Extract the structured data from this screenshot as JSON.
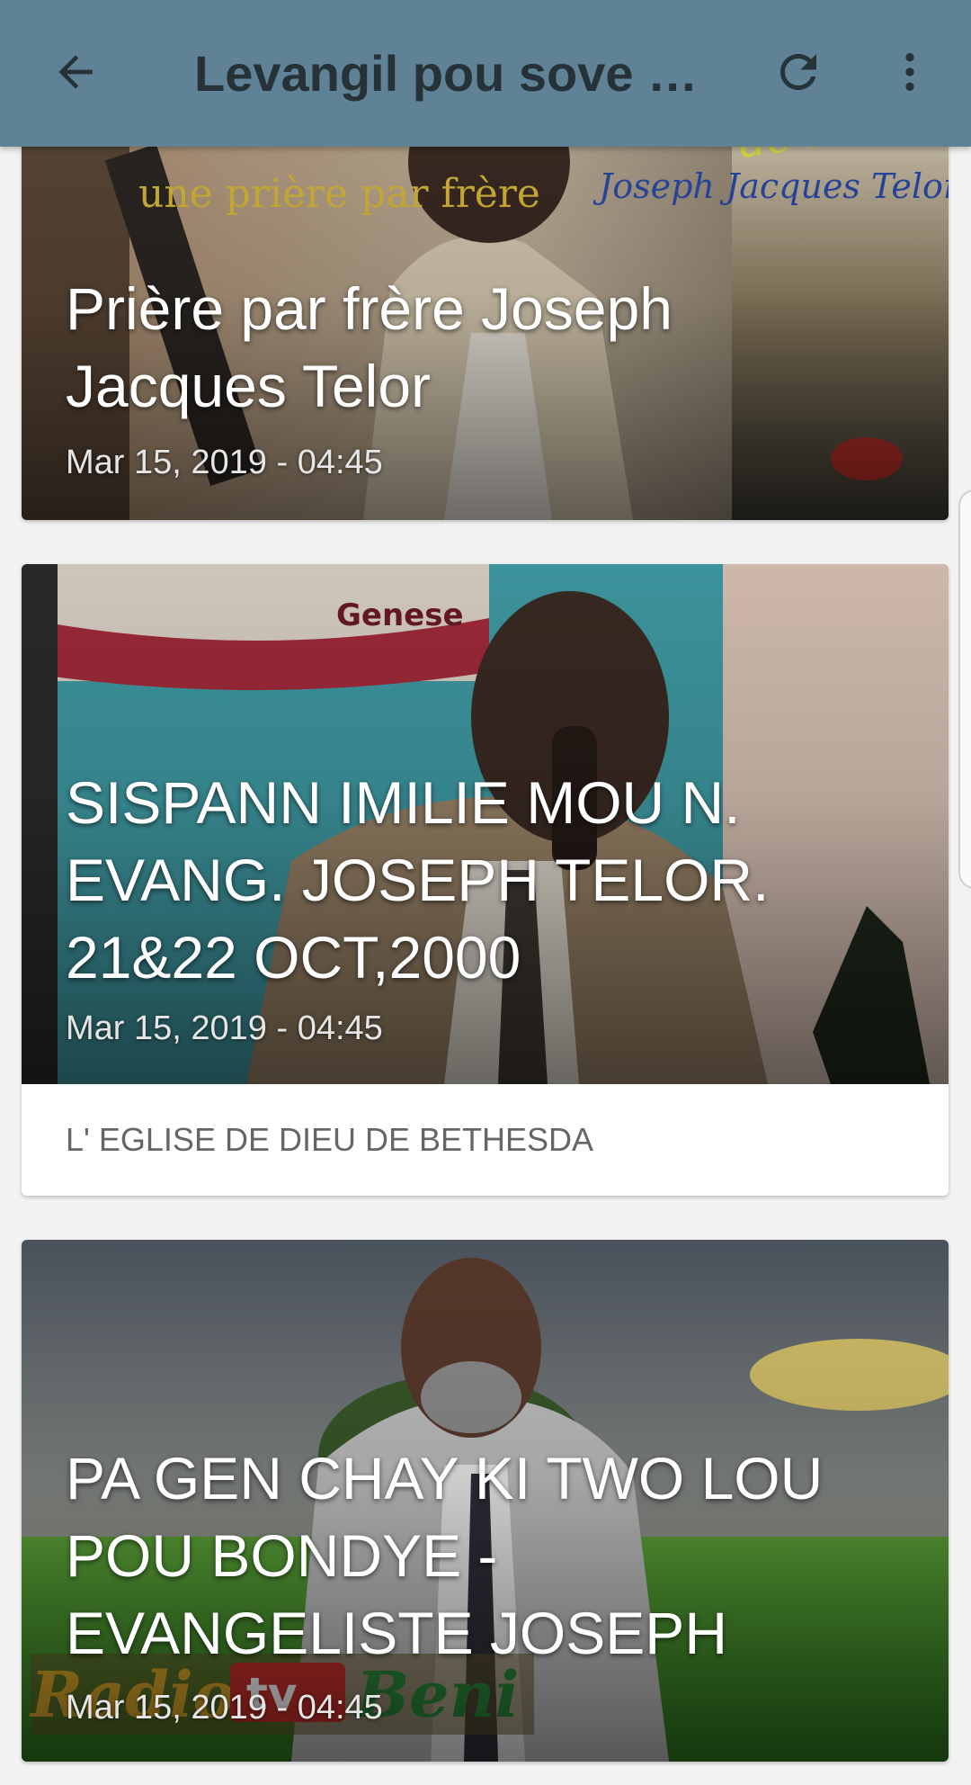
{
  "appbar": {
    "title": "Levangil pou sove n...",
    "back_icon": "arrow-left-icon",
    "refresh_icon": "refresh-icon",
    "more_icon": "more-vertical-icon",
    "color": "#5f8296"
  },
  "cards": [
    {
      "headline": "Prière par frère Joseph Jacques Telor",
      "date": "Mar 15, 2019 - 04:45",
      "image_text": [
        "une prière par frère",
        "de l'Hom",
        "Joseph Jacques Telor"
      ]
    },
    {
      "headline": "SISPANN IMILIE MOU N. EVANG. JOSEPH TELOR. 21&22 OCT,2000",
      "date": "Mar 15, 2019 - 04:45",
      "source": "L' EGLISE DE DIEU DE BETHESDA",
      "image_text": [
        "Genese"
      ]
    },
    {
      "headline": "PA GEN CHAY KI TWO LOU POU BONDYE - EVANGELISTE JOSEPH",
      "date": "Mar 15, 2019 - 04:45",
      "image_text": [
        "Radio",
        "tv",
        "Beni"
      ]
    }
  ]
}
